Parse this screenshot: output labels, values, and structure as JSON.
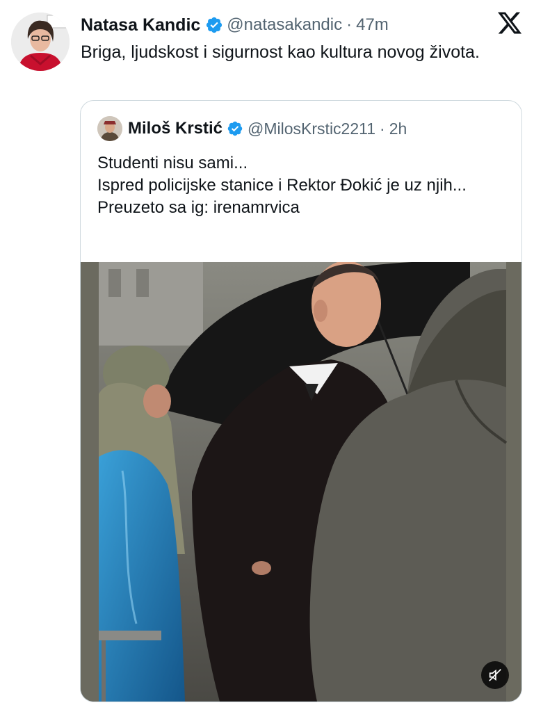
{
  "tweet": {
    "author_name": "Natasa Kandic",
    "handle": "@natasakandic",
    "separator": "·",
    "time": "47m",
    "text": "Briga, ljudskost i sigurnost kao kultura novog života."
  },
  "quote": {
    "author_name": "Miloš Krstić",
    "handle": "@MilosKrstic2211",
    "separator": "·",
    "time": "2h",
    "lines": [
      "Studenti nisu sami...",
      "Ispred policijske stanice i Rektor Đokić je uz njih...",
      "Preuzeto sa ig: irenamrvica"
    ]
  },
  "icons": {
    "verified": "verified-badge-icon",
    "platform": "x-logo-icon",
    "mute": "muted-speaker-icon"
  },
  "colors": {
    "verified": "#1d9bf0",
    "secondary_text": "#536471",
    "primary_text": "#0f1419",
    "border": "#cfd9de"
  }
}
